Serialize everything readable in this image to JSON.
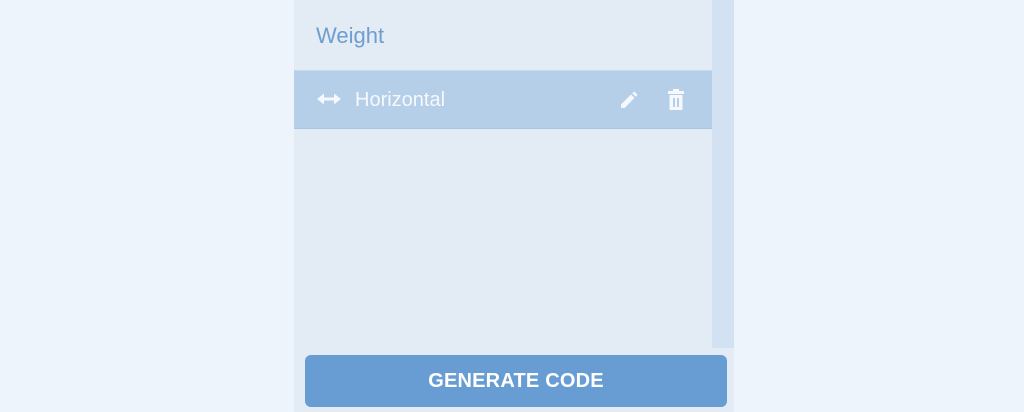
{
  "panel": {
    "section_title": "Weight",
    "items": [
      {
        "label": "Horizontal",
        "icon": "horizontal-arrows-icon",
        "actions": [
          "pencil-icon",
          "trash-icon"
        ]
      }
    ]
  },
  "footer": {
    "generate_label": "GENERATE CODE"
  },
  "colors": {
    "page_background": "#eef4fb",
    "panel_background": "#e3ebf4",
    "title_text": "#6e9ecf",
    "selected_row": "#b5cfe9",
    "button": "#689dd3",
    "scroll_track": "#d3e2f2"
  }
}
